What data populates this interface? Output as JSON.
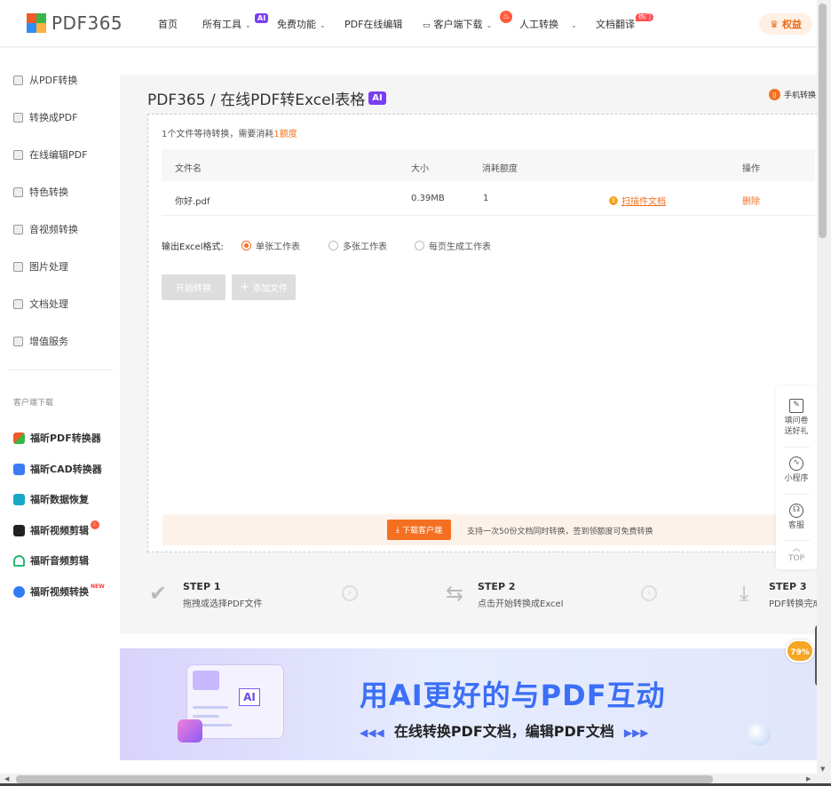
{
  "brand": {
    "logo_text": "PDF365",
    "colors": {
      "accent": "#f37021",
      "ai_badge": "#7b3ff2",
      "banner_title": "#3b6ff5"
    }
  },
  "nav": {
    "home": "首页",
    "all_tools": "所有工具",
    "ai_badge": "AI",
    "free": "免费功能",
    "online_edit": "PDF在线编辑",
    "client_download": "客户端下载",
    "manual_convert": "人工转换",
    "doc_translate": "文档翻译",
    "hot_badge": "热门",
    "rights": "权益"
  },
  "sidebar": {
    "items": [
      {
        "label": "从PDF转换",
        "icon": "from-pdf-icon"
      },
      {
        "label": "转换成PDF",
        "icon": "to-pdf-icon"
      },
      {
        "label": "在线编辑PDF",
        "icon": "edit-pdf-icon"
      },
      {
        "label": "特色转换",
        "icon": "shield-icon"
      },
      {
        "label": "音视频转换",
        "icon": "media-icon"
      },
      {
        "label": "图片处理",
        "icon": "image-icon"
      },
      {
        "label": "文档处理",
        "icon": "document-icon"
      },
      {
        "label": "增值服务",
        "icon": "list-icon"
      }
    ],
    "section_title": "客户端下载",
    "apps": [
      {
        "label": "福昕PDF转换器",
        "color": "#f37021"
      },
      {
        "label": "福昕CAD转换器",
        "color": "#3b7cf5"
      },
      {
        "label": "福昕数据恢复",
        "color": "#1aa8c8"
      },
      {
        "label": "福昕视频剪辑",
        "color": "#222222"
      },
      {
        "label": "福昕音频剪辑",
        "color": "#2bb673"
      },
      {
        "label": "福昕视频转换",
        "color": "#2f7df6"
      }
    ],
    "new_tag": "NEW"
  },
  "main": {
    "title": "PDF365 / 在线PDF转Excel表格",
    "title_badge": "AI",
    "mobile_link": "手机转换",
    "queue_prefix": "1个文件等待转换，需要消耗",
    "queue_highlight": "1额度",
    "table": {
      "headers": [
        "文件名",
        "大小",
        "消耗额度",
        "操作"
      ],
      "row": {
        "name": "你好.pdf",
        "size": "0.39MB",
        "cost": "1",
        "scan": "扫描件文档",
        "delete": "删除"
      }
    },
    "format_label": "输出Excel格式:",
    "formats": [
      {
        "label": "单张工作表",
        "selected": true
      },
      {
        "label": "多张工作表",
        "selected": false
      },
      {
        "label": "每页生成工作表",
        "selected": false
      }
    ],
    "start_button": "开始转换",
    "add_button": "添加文件",
    "download_button": "下载客户端",
    "download_note": "支持一次50份文档同时转换，签到领额度可免费转换"
  },
  "steps": [
    {
      "title": "STEP 1",
      "desc": "拖拽或选择PDF文件"
    },
    {
      "title": "STEP 2",
      "desc": "点击开始转换成Excel"
    },
    {
      "title": "STEP 3",
      "desc": "PDF转换完成"
    }
  ],
  "banner": {
    "title": "用AI更好的与PDF互动",
    "subtitle": "在线转换PDF文档，编辑PDF文档",
    "ai_label": "AI"
  },
  "float_tools": {
    "survey": "填问卷送好礼",
    "mini_program": "小程序",
    "service": "客服",
    "top": "TOP"
  },
  "progress": {
    "label": "79%",
    "value": 0.79
  }
}
